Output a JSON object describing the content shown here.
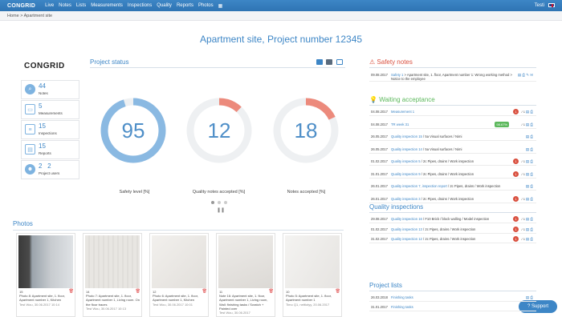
{
  "topbar": {
    "logo": "CONGRID",
    "nav": [
      "Live",
      "Notes",
      "Lists",
      "Measurements",
      "Inspections",
      "Quality",
      "Reports",
      "Photos"
    ],
    "user": "Testi"
  },
  "breadcrumb": "Home > Apartment site",
  "page_title": "Apartment site, Project number 12345",
  "brand": "CONGRID",
  "stats": [
    {
      "icon": "search-icon",
      "value": "44",
      "label": "Notes"
    },
    {
      "icon": "ruler-icon",
      "value": "5",
      "label": "Measurements"
    },
    {
      "icon": "clipboard-icon",
      "value": "15",
      "label": "Inspections"
    },
    {
      "icon": "document-icon",
      "value": "15",
      "label": "Reports"
    },
    {
      "icon": "users-icon",
      "value": "2   2",
      "label": "Project users"
    }
  ],
  "project_status": {
    "title": "Project status",
    "gauges": [
      {
        "value": "95",
        "percent": 95,
        "color": "#8ab9e2",
        "label": "Safety level [%]"
      },
      {
        "value": "12",
        "percent": 12,
        "color": "#ec8a7c",
        "label": "Quality notes accepted [%]"
      },
      {
        "value": "18",
        "percent": 18,
        "color": "#ec8a7c",
        "label": "Notes accepted [%]"
      }
    ]
  },
  "photos": {
    "title": "Photos",
    "items": [
      {
        "count": "15",
        "text": "Photo 8: Apartment site, 1. floor, Apartment number 1, Kitchen",
        "date": "Test Wou, 30.06.2017 10:14"
      },
      {
        "count": "14",
        "text": "Photo 7: Apartment site, 1. floor, Apartment number 1, Living room. On the floor traces",
        "date": "Test Wou, 30.06.2017 10:13"
      },
      {
        "count": "12",
        "text": "Photo 6: Apartment site, 1. floor, Apartment number 1, Kitchen",
        "date": "Test Wou, 30.06.2017 10:01"
      },
      {
        "count": "11",
        "text": "Note 16: Apartment site, 1. floor, Apartment number 1, Living room, Wall: finishing tasks / Scratch + Painted over",
        "date": "Test Wou, 30.06.2017"
      },
      {
        "count": "10",
        "text": "Photo 5: Apartment site, 1. floor, Apartment number 1",
        "date": "Timo Q1, nettiotyy, 20.06.2017"
      }
    ]
  },
  "safety_notes": {
    "title": "Safety notes",
    "rows": [
      {
        "date": "09.08.2017",
        "link": "Safety 1",
        "text": " > Apartment site, 1. floor, Apartment number 1: Wrong working method > Notice to the employee"
      }
    ]
  },
  "waiting_acceptance": {
    "title": "Waiting acceptance",
    "rows": [
      {
        "date": "04.08.2017",
        "link": "Measurement 1",
        "text": "",
        "badge": "1",
        "count": "/ 1",
        "pct": ""
      },
      {
        "date": "04.08.2017",
        "link": "TR week 31",
        "text": "",
        "badge": "",
        "count": "/ 1",
        "pct": "98.67%"
      },
      {
        "date": "26.05.2017",
        "link": "Quality inspection 15",
        "text": " / 5a Visual surfaces / Nimi",
        "badge": "",
        "count": "",
        "pct": ""
      },
      {
        "date": "26.05.2017",
        "link": "Quality inspection 14",
        "text": " / 5a Visual surfaces / Nimi",
        "badge": "",
        "count": "",
        "pct": ""
      },
      {
        "date": "01.02.2017",
        "link": "Quality inspection 5",
        "text": " / 2c Pipes, drains / Work inspection",
        "badge": "1",
        "count": "/ 1",
        "pct": ""
      },
      {
        "date": "31.01.2017",
        "link": "Quality inspection 9",
        "text": " / 2c Pipes, drains / Work inspection",
        "badge": "1",
        "count": "/ 1",
        "pct": ""
      },
      {
        "date": "26.01.2017",
        "link": "Quality inspection 7, inspection report",
        "text": " / 2c Pipes, drains / Work inspection",
        "badge": "",
        "count": "",
        "pct": ""
      },
      {
        "date": "26.01.2017",
        "link": "Quality inspection 3",
        "text": " / 2c Pipes, drains / Work inspection",
        "badge": "1",
        "count": "/ 1",
        "pct": ""
      }
    ]
  },
  "quality_inspections": {
    "title": "Quality inspections",
    "rows": [
      {
        "date": "29.08.2017",
        "link": "Quality inspection 16",
        "text": " / F10 Brick / block walling / Model inspection",
        "badge": "1",
        "count": "/ 1"
      },
      {
        "date": "01.02.2017",
        "link": "Quality inspection 13",
        "text": " / 2c Pipes, drains / Work inspection",
        "badge": "1",
        "count": "/ 1"
      },
      {
        "date": "31.02.2017",
        "link": "Quality inspection 12",
        "text": " / 2c Pipes, drains / Work inspection",
        "badge": "1",
        "count": "/ 1"
      }
    ]
  },
  "project_lists": {
    "title": "Project lists",
    "rows": [
      {
        "date": "26.03.2018",
        "link": "Finishing tasks"
      },
      {
        "date": "31.01.2017",
        "link": "Finishing tasks"
      }
    ]
  },
  "support_label": "Support",
  "colors": {
    "accent": "#3d86c6",
    "safety": "#d9503f",
    "waiting": "#5cb85c"
  }
}
